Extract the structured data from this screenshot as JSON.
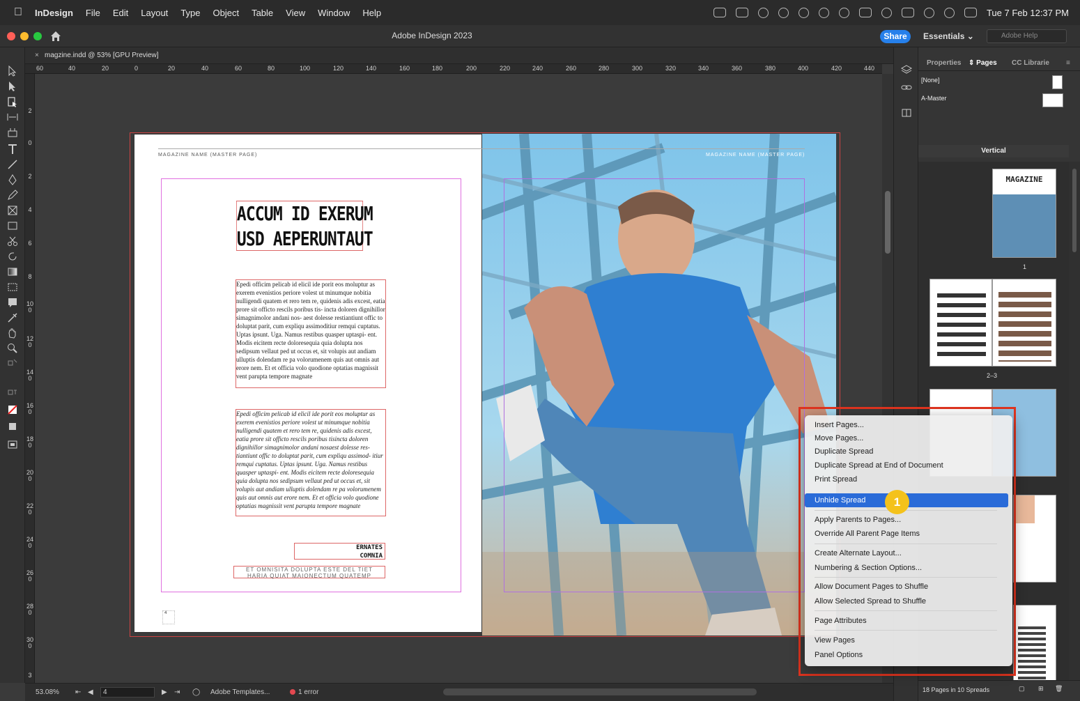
{
  "menubar": {
    "app_name": "InDesign",
    "items": [
      "File",
      "Edit",
      "Layout",
      "Type",
      "Object",
      "Table",
      "View",
      "Window",
      "Help"
    ],
    "clock": "Tue 7 Feb  12:37 PM"
  },
  "titlebar": {
    "title": "Adobe InDesign 2023",
    "share_label": "Share",
    "workspace_label": "Essentials",
    "help_placeholder": "Adobe Help"
  },
  "document_tab": {
    "close_glyph": "×",
    "label": "magzine.indd @ 53% [GPU Preview]"
  },
  "rulers": {
    "horizontal": [
      "60",
      "40",
      "20",
      "0",
      "20",
      "40",
      "60",
      "80",
      "100",
      "120",
      "140",
      "160",
      "180",
      "200",
      "220",
      "240",
      "260",
      "280",
      "300",
      "320",
      "340",
      "360",
      "380",
      "400",
      "420",
      "440"
    ],
    "vertical": [
      "2",
      "0",
      "2",
      "4",
      "6",
      "8",
      "100",
      "120",
      "140",
      "160",
      "180",
      "200",
      "220",
      "240",
      "260",
      "280",
      "300",
      "3"
    ]
  },
  "spread": {
    "left_header": "MAGAZINE NAME (MASTER PAGE)",
    "right_header": "MAGAZINE NAME (MASTER PAGE)",
    "headline_line1": "ACCUM ID EXERUM",
    "headline_line2": "USD AEPERUNTAUT",
    "body1": "Epedi officim pelicab id elicil ide porit eos moluptur as exerem evenistios periore volest ut minumque nobitia nulligendi quatem et rero tem re, quidenis adis excest, eatia prore sit officto rescils poribus tis- incta doloren dignihillor simagnimolor andani nos- aest dolesse restiantiunt offic to doluptat parit, cum expliqu assimoditiur remqui cuptatus. Uptas ipsunt. Uga. Namus restibus quasper uptaspi- ent. Modis eicitem recte doloresequia quia dolupta nos sedipsum vellaut ped ut occus et, sit volupis aut andiam ulluptis dolendam re pa volorumenem quis aut omnis aut erore nem. Et et officia volo quodione optatias magnissit vent parupta tempore magnate",
    "body2": "Epedi officim pelicab id elicil ide porit eos moluptur as exerem evenistios periore volest ut minumque nobitia nulligendi quatem et rero tem re, quidenis adis excest, eatia prore sit officto rescils poribus tisincta doloren dignihillor simagnimolor andani nosaest dolesse res- tiantiunt offic to doluptat parit, cum expliqu assimod- itiur remqui cuptatus. Uptas ipsunt. Uga. Namus restibus quasper uptaspi- ent. Modis eicitem recte doloresequia quia dolupta nos sedipsum vellaut ped ut occus et, sit volupis aut andiam ulluptis dolendam re pa volorumenem quis aut omnis aut erore nem. Et et officia volo quodione optatias magnissit vent parupta tempore magnate",
    "ernates_line1": "ERNATES",
    "ernates_line2": "COMNIA",
    "caption_line1": "ET OMNISITA DOLUPTA ESTE DEL TIET",
    "caption_line2": "HARIA QUIAT MAIONECTUM QUATEMP",
    "page_number": "4"
  },
  "statusbar": {
    "zoom": "53.08%",
    "page_field": "4",
    "preflight_profile": "Adobe Templates...",
    "error_text": "1 error"
  },
  "panel": {
    "tabs": [
      "Properties",
      "Pages",
      "CC Librarie"
    ],
    "active_tab": "Pages",
    "masters": [
      "[None]",
      "A-Master"
    ],
    "orientation_label": "Vertical",
    "thumb_magazine_title": "MAGAZINE",
    "page_labels": [
      "1",
      "2–3"
    ],
    "footer_text": "18 Pages in 10 Spreads"
  },
  "context_menu": {
    "items": [
      "Insert Pages...",
      "Move Pages...",
      "Duplicate Spread",
      "Duplicate Spread at End of Document",
      "Print Spread",
      "Unhide Spread",
      "Apply Parents to Pages...",
      "Override All Parent Page Items",
      "Create Alternate Layout...",
      "Numbering & Section Options...",
      "Allow Document Pages to Shuffle",
      "Allow Selected Spread to Shuffle",
      "Page Attributes",
      "View Pages",
      "Panel Options"
    ],
    "selected": "Unhide Spread",
    "badge": "1"
  },
  "colors": {
    "accent": "#2a6bd8",
    "share": "#2680eb",
    "highlight_box": "#e0341f",
    "badge": "#f4c21b",
    "error": "#e34850"
  }
}
